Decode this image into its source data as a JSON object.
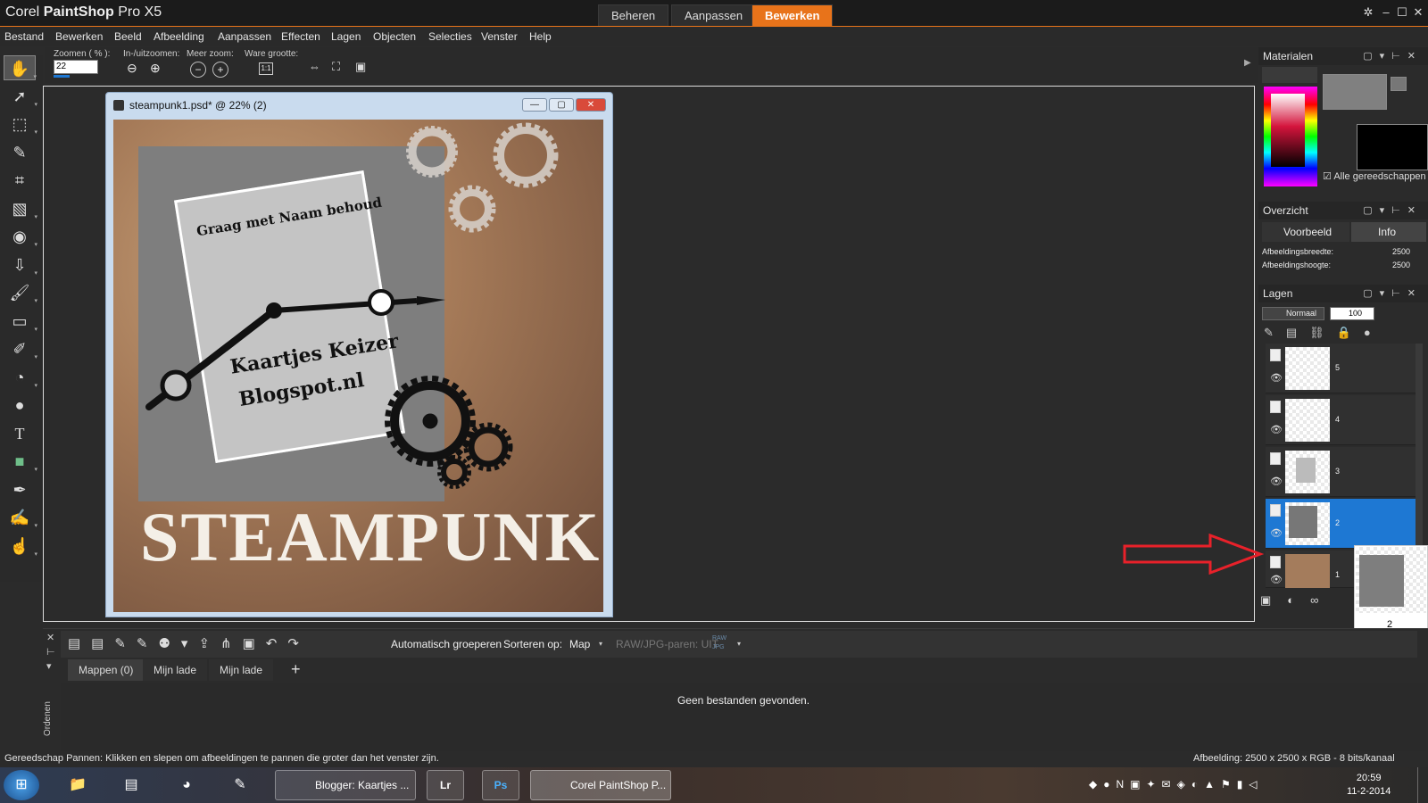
{
  "app": {
    "title_prefix": "Corel ",
    "title_bold": "PaintShop",
    "title_suffix": " Pro X5",
    "workspace_tabs": [
      "Beheren",
      "Aanpassen",
      "Bewerken"
    ],
    "active_workspace": "Bewerken"
  },
  "menu": [
    "Bestand",
    "Bewerken",
    "Beeld",
    "Afbeelding",
    "Aanpassen",
    "Effecten",
    "Lagen",
    "Objecten",
    "Selecties",
    "Venster",
    "Help"
  ],
  "options": {
    "zoom_label": "Zoomen ( % ):",
    "zoom_value": "22",
    "inout_label": "In-/uitzoomen:",
    "more_label": "Meer zoom:",
    "actual_label": "Ware grootte:",
    "actual_btn": "1:1"
  },
  "document": {
    "title": "steampunk1.psd* @  22% (2)",
    "card_line1": "Graag met Naam behoud",
    "card_line2": "Kaartjes Keizer",
    "card_line3": "Blogspot.nl",
    "big_text": "STEAMPUNK"
  },
  "panels": {
    "materials": {
      "title": "Materialen",
      "all_tools": "Alle gereedschappen"
    },
    "overview": {
      "title": "Overzicht",
      "tab_preview": "Voorbeeld",
      "tab_info": "Info",
      "width_label": "Afbeeldingsbreedte:",
      "width_value": "2500",
      "height_label": "Afbeeldingshoogte:",
      "height_value": "2500"
    },
    "layers": {
      "title": "Lagen",
      "blend": "Normaal",
      "opacity": "100",
      "items": [
        {
          "num": "5"
        },
        {
          "num": "4"
        },
        {
          "num": "3"
        },
        {
          "num": "2"
        },
        {
          "num": "1"
        }
      ],
      "selected": "2",
      "tooltip_num": "2"
    }
  },
  "organizer": {
    "auto_group": "Automatisch groeperen",
    "sort_label": "Sorteren op:",
    "sort_value": "Map",
    "raw_pairs": "RAW/JPG-paren: UIT",
    "raw_icon": "RAW JPG",
    "tabs": [
      "Mappen (0)",
      "Mijn lade",
      "Mijn lade"
    ],
    "empty": "Geen bestanden gevonden.",
    "side_label": "Ordenen"
  },
  "status": {
    "left": "Gereedschap Pannen: Klikken en slepen om afbeeldingen te pannen die groter dan het venster zijn.",
    "right": "Afbeelding:  2500 x 2500 x RGB - 8 bits/kanaal"
  },
  "taskbar": {
    "tasks": [
      "Blogger: Kaartjes ...",
      "Lr",
      "Ps",
      "Corel PaintShop P..."
    ],
    "time": "20:59",
    "date": "11-2-2014"
  },
  "colors": {
    "accent": "#e8731a",
    "selected_layer": "#1e78d3"
  }
}
